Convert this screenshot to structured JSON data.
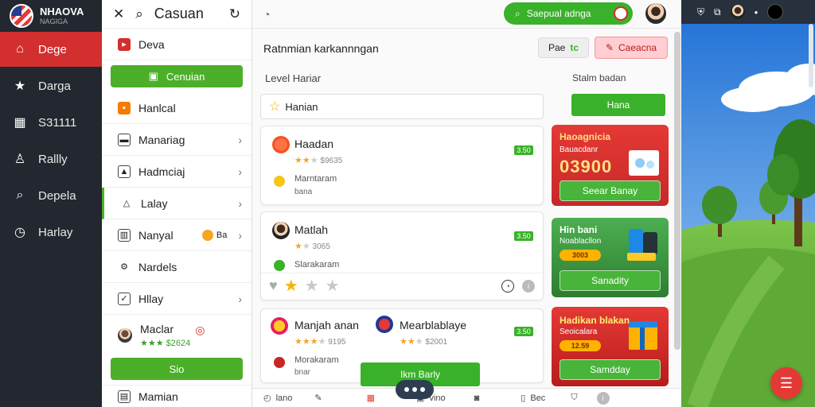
{
  "app": {
    "brand_title": "NHAOVA",
    "brand_sub": "NAGIGA"
  },
  "left_nav": [
    {
      "label": "Dege",
      "icon": "home-icon"
    },
    {
      "label": "Darga",
      "icon": "star-icon"
    },
    {
      "label": "S31111",
      "icon": "chart-icon"
    },
    {
      "label": "Rallly",
      "icon": "person-icon"
    },
    {
      "label": "Depela",
      "icon": "search-icon"
    },
    {
      "label": "Harlay",
      "icon": "clock-icon"
    }
  ],
  "middle": {
    "title": "Casuan",
    "rows": [
      {
        "label": "Deva"
      },
      {
        "label": "Cenuian",
        "button": true
      },
      {
        "label": "Hanlcal"
      },
      {
        "label": "Manariag"
      },
      {
        "label": "Hadmciaj"
      },
      {
        "label": "Lalay"
      },
      {
        "label": "Nanyal",
        "coin_text": "Ba"
      },
      {
        "label": "Nardels"
      },
      {
        "label": "Hllay"
      },
      {
        "label": "Maclar",
        "sub": "$2624"
      }
    ],
    "action_button": "Sio",
    "footer_label": "Mamian"
  },
  "topbar": {
    "search_label": "Saepual adnga",
    "search_placeholder": ""
  },
  "main": {
    "header": "Ratnmian karkannngan",
    "btn_plain": "Pae",
    "btn_plain_suffix": "tc",
    "btn_pink": "Caeacna",
    "section_left": "Level Hariar",
    "section_right": "Stalm badan",
    "field_value": "Hanian",
    "right_button": "Hana",
    "cards": [
      {
        "title": "Haadan",
        "meta": "$9635",
        "desc": "Marntaram",
        "sub": "bana",
        "tag": "3.50",
        "rating": 2
      },
      {
        "title": "Matlah",
        "meta": "3065",
        "desc": "Slarakaram",
        "tag": "3.50",
        "rating": 1
      },
      {
        "title": "Manjah anan",
        "meta": "9195",
        "desc": "Morakaram",
        "sub": "bnar",
        "tag": "3.50",
        "rating": 3,
        "title2": "Mearblablaye",
        "meta2": "$2001"
      }
    ],
    "promos": [
      {
        "title": "Haoagnicia",
        "sub": "Bauacdanr",
        "amount": "03900",
        "button": "Seear Banay",
        "bg": "#e53935"
      },
      {
        "title": "Hin bani",
        "sub": "Noablacllon",
        "pill": "3003",
        "button": "Sanadity",
        "bg": "#43a047"
      },
      {
        "title": "Hadikan blakan",
        "sub": "Seoicalara",
        "pill": "12.59",
        "button": "Samdday",
        "bg": "#e53935"
      }
    ],
    "float_button": "Ikm Barly",
    "bottom_items": [
      "lano",
      "",
      "",
      "vino",
      "",
      "Bec"
    ]
  },
  "colors": {
    "accent_green": "#3ab12a",
    "active_red": "#d32f2f",
    "sidebar_dark": "#23272f"
  }
}
